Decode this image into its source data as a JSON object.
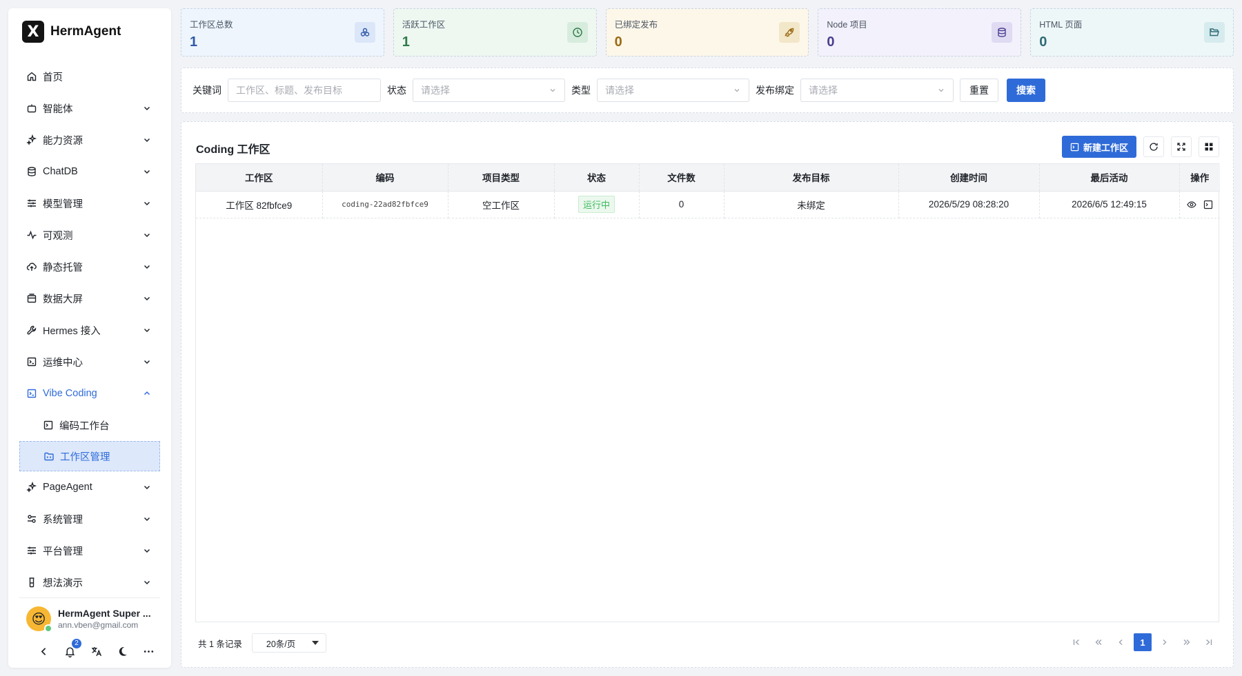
{
  "brand": {
    "logo": "X",
    "name": "HermAgent"
  },
  "menu": [
    {
      "label": "首页",
      "icon": "home-icon",
      "expandable": false
    },
    {
      "label": "智能体",
      "icon": "bot-icon",
      "expandable": true
    },
    {
      "label": "能力资源",
      "icon": "sparkles-icon",
      "expandable": true
    },
    {
      "label": "ChatDB",
      "icon": "database-icon",
      "expandable": true
    },
    {
      "label": "模型管理",
      "icon": "sliders-icon",
      "expandable": true
    },
    {
      "label": "可观测",
      "icon": "activity-icon",
      "expandable": true
    },
    {
      "label": "静态托管",
      "icon": "cloud-upload-icon",
      "expandable": true
    },
    {
      "label": "数据大屏",
      "icon": "monitor-icon",
      "expandable": true
    },
    {
      "label": "Hermes 接入",
      "icon": "wrench-icon",
      "expandable": true
    },
    {
      "label": "运维中心",
      "icon": "terminal-icon",
      "expandable": true
    },
    {
      "label": "Vibe Coding",
      "icon": "code-square-icon",
      "expandable": true,
      "expanded": true,
      "children": [
        {
          "label": "编码工作台",
          "icon": "terminal-square-icon"
        },
        {
          "label": "工作区管理",
          "icon": "folder-code-icon",
          "selected": true
        }
      ]
    },
    {
      "label": "PageAgent",
      "icon": "sparkles-icon",
      "expandable": true
    },
    {
      "label": "系统管理",
      "icon": "settings-toggle-icon",
      "expandable": true
    },
    {
      "label": "平台管理",
      "icon": "sliders-icon",
      "expandable": true
    },
    {
      "label": "想法演示",
      "icon": "flask-icon",
      "expandable": true
    }
  ],
  "user": {
    "name": "HermAgent Super ...",
    "email": "ann.vben@gmail.com",
    "avatar": "😍"
  },
  "notifications": {
    "count": "2"
  },
  "stats": [
    {
      "label": "工作区总数",
      "value": "1",
      "icon": "boxes-icon",
      "bg": "#eef5fd",
      "icon_bg": "#dbe6f8",
      "color": "#2f5aa8"
    },
    {
      "label": "活跃工作区",
      "value": "1",
      "icon": "clock-icon",
      "bg": "#eef8f1",
      "icon_bg": "#d7ecdd",
      "color": "#2f7a4a"
    },
    {
      "label": "已绑定发布",
      "value": "0",
      "icon": "rocket-icon",
      "bg": "#fdf7e9",
      "icon_bg": "#f3e7c9",
      "color": "#9a6a14"
    },
    {
      "label": "Node 项目",
      "value": "0",
      "icon": "database-icon",
      "bg": "#f3f1fb",
      "icon_bg": "#e0dbf3",
      "color": "#4b3f8f"
    },
    {
      "label": "HTML 页面",
      "value": "0",
      "icon": "folder-open-icon",
      "bg": "#eef7f8",
      "icon_bg": "#d6ebee",
      "color": "#2e6b75"
    }
  ],
  "filters": {
    "keyword_label": "关键词",
    "keyword_placeholder": "工作区、标题、发布目标",
    "status_label": "状态",
    "status_placeholder": "请选择",
    "type_label": "类型",
    "type_placeholder": "请选择",
    "bind_label": "发布绑定",
    "bind_placeholder": "请选择",
    "reset_label": "重置",
    "search_label": "搜索"
  },
  "main": {
    "title": "Coding 工作区",
    "new_button": "新建工作区",
    "columns": [
      "工作区",
      "编码",
      "项目类型",
      "状态",
      "文件数",
      "发布目标",
      "创建时间",
      "最后活动",
      "操作"
    ],
    "rows": [
      {
        "workspace": "工作区 82fbfce9",
        "code": "coding-22ad82fbfce9",
        "type": "空工作区",
        "status": "运行中",
        "files": "0",
        "target": "未绑定",
        "created": "2026/5/29 08:28:20",
        "last_active": "2026/6/5 12:49:15"
      }
    ]
  },
  "pagination": {
    "total": "共 1 条记录",
    "page_size": "20条/页",
    "current_page": "1"
  }
}
